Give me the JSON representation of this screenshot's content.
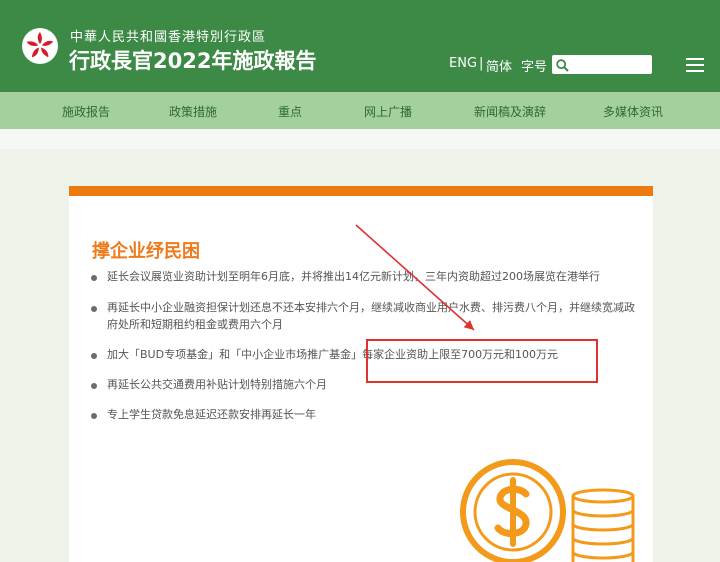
{
  "header": {
    "gov_name": "中華人民共和國香港特別行政區",
    "report_title": "行政長官2022年施政報告",
    "lang_eng": "ENG",
    "lang_separator": "|",
    "lang_simplified": "简体",
    "font_size_label": "字号",
    "search_value": ""
  },
  "nav": {
    "items": [
      "施政报告",
      "政策措施",
      "重点",
      "网上广播",
      "新闻稿及演辞",
      "多媒体资讯"
    ]
  },
  "content": {
    "section_title": "撑企业纾民困",
    "items": [
      "延长会议展览业资助计划至明年6月底，并将推出14亿元新计划，三年内资助超过200场展览在港举行",
      "再延长中小企业融资担保计划还息不还本安排六个月，继续减收商业用户水费、排污费八个月，并继续宽减政府处所和短期租约租金或费用六个月",
      "加大「BUD专项基金」和「中小企业市场推广基金」每家企业资助上限至700万元和100万元",
      "再延长公共交通费用补贴计划特别措施六个月",
      "专上学生贷款免息延迟还款安排再延长一年"
    ]
  },
  "colors": {
    "header_green": "#3d8a46",
    "nav_green": "#a4d09d",
    "accent_orange": "#ec7a0f",
    "annotation_red": "#e03030"
  },
  "icons": {
    "emblem": "bauhinia-emblem-icon",
    "search": "search-icon",
    "menu": "hamburger-menu-icon",
    "illustration": "dollar-coin-stack-icon"
  }
}
